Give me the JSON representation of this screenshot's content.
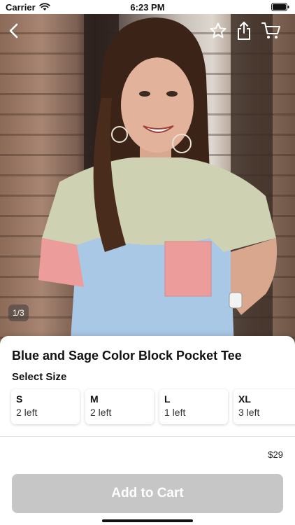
{
  "status_bar": {
    "carrier": "Carrier",
    "time": "6:23 PM",
    "icons": [
      "wifi-icon",
      "battery-icon"
    ]
  },
  "image_nav": {
    "icons": [
      "chevron-left-icon",
      "star-icon",
      "share-icon",
      "cart-icon"
    ]
  },
  "gallery": {
    "page_indicator": "1/3"
  },
  "product": {
    "title": "Blue and Sage Color Block Pocket Tee",
    "select_size_label": "Select Size",
    "sizes": [
      {
        "name": "S",
        "stock": "2 left"
      },
      {
        "name": "M",
        "stock": "2 left"
      },
      {
        "name": "L",
        "stock": "1 left"
      },
      {
        "name": "XL",
        "stock": "3 left"
      }
    ],
    "price": "$29"
  },
  "actions": {
    "add_to_cart_label": "Add to Cart"
  },
  "colors": {
    "button_disabled": "#c6c6c6",
    "shirt_blue": "#a9c8e6",
    "shirt_sage": "#cfd2b2",
    "shirt_pink": "#ec9d9b"
  }
}
